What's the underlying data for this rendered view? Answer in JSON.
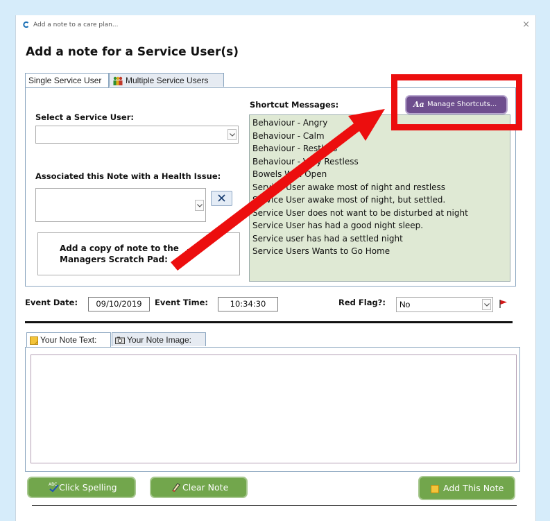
{
  "window": {
    "title": "Add a note to a care plan...",
    "close_glyph": "×"
  },
  "heading": "Add a note for a Service User(s)",
  "tabs_top": [
    {
      "label": "Single Service User",
      "active": true
    },
    {
      "label": "Multiple Service Users",
      "active": false,
      "icon": "group-icon"
    }
  ],
  "single_tab": {
    "select_label": "Select a Service User:",
    "select_value": "",
    "health_label": "Associated this Note with a Health Issue:",
    "health_value": "",
    "clear_glyph": "✕",
    "copy_line1": "Add a copy of note to the",
    "copy_line2": "Managers Scratch Pad:",
    "copy_checked": false
  },
  "shortcuts": {
    "label": "Shortcut Messages:",
    "manage_button": "Manage Shortcuts...",
    "manage_icon": "Aa",
    "items": [
      "Behaviour - Angry",
      "Behaviour - Calm",
      "Behaviour - Restless",
      "Behaviour - Very Restless",
      "Bowels Well Open",
      "Service User awake most of night and restless",
      "Service User awake most of night, but settled.",
      "Service User does not want to be disturbed at night",
      "Service User has had a good night sleep.",
      "Service user has had a settled night",
      "Service Users Wants to Go Home"
    ]
  },
  "event": {
    "date_label": "Event Date:",
    "date_value": "09/10/2019",
    "time_label": "Event Time:",
    "time_value": "10:34:30",
    "flag_label": "Red Flag?:",
    "flag_value": "No"
  },
  "note_tabs": [
    {
      "label": "Your Note Text:",
      "active": true,
      "icon": "note-icon"
    },
    {
      "label": "Your Note Image:",
      "active": false,
      "icon": "camera-icon"
    }
  ],
  "note_text": "",
  "buttons": {
    "spelling": "Click Spelling",
    "clear": "Clear Note",
    "add": "Add This Note"
  },
  "colors": {
    "accent_purple": "#6e4e8e",
    "button_green": "#72a64c",
    "annotation_red": "#ec0e0e",
    "shortcut_bg": "#dfe9d4"
  }
}
